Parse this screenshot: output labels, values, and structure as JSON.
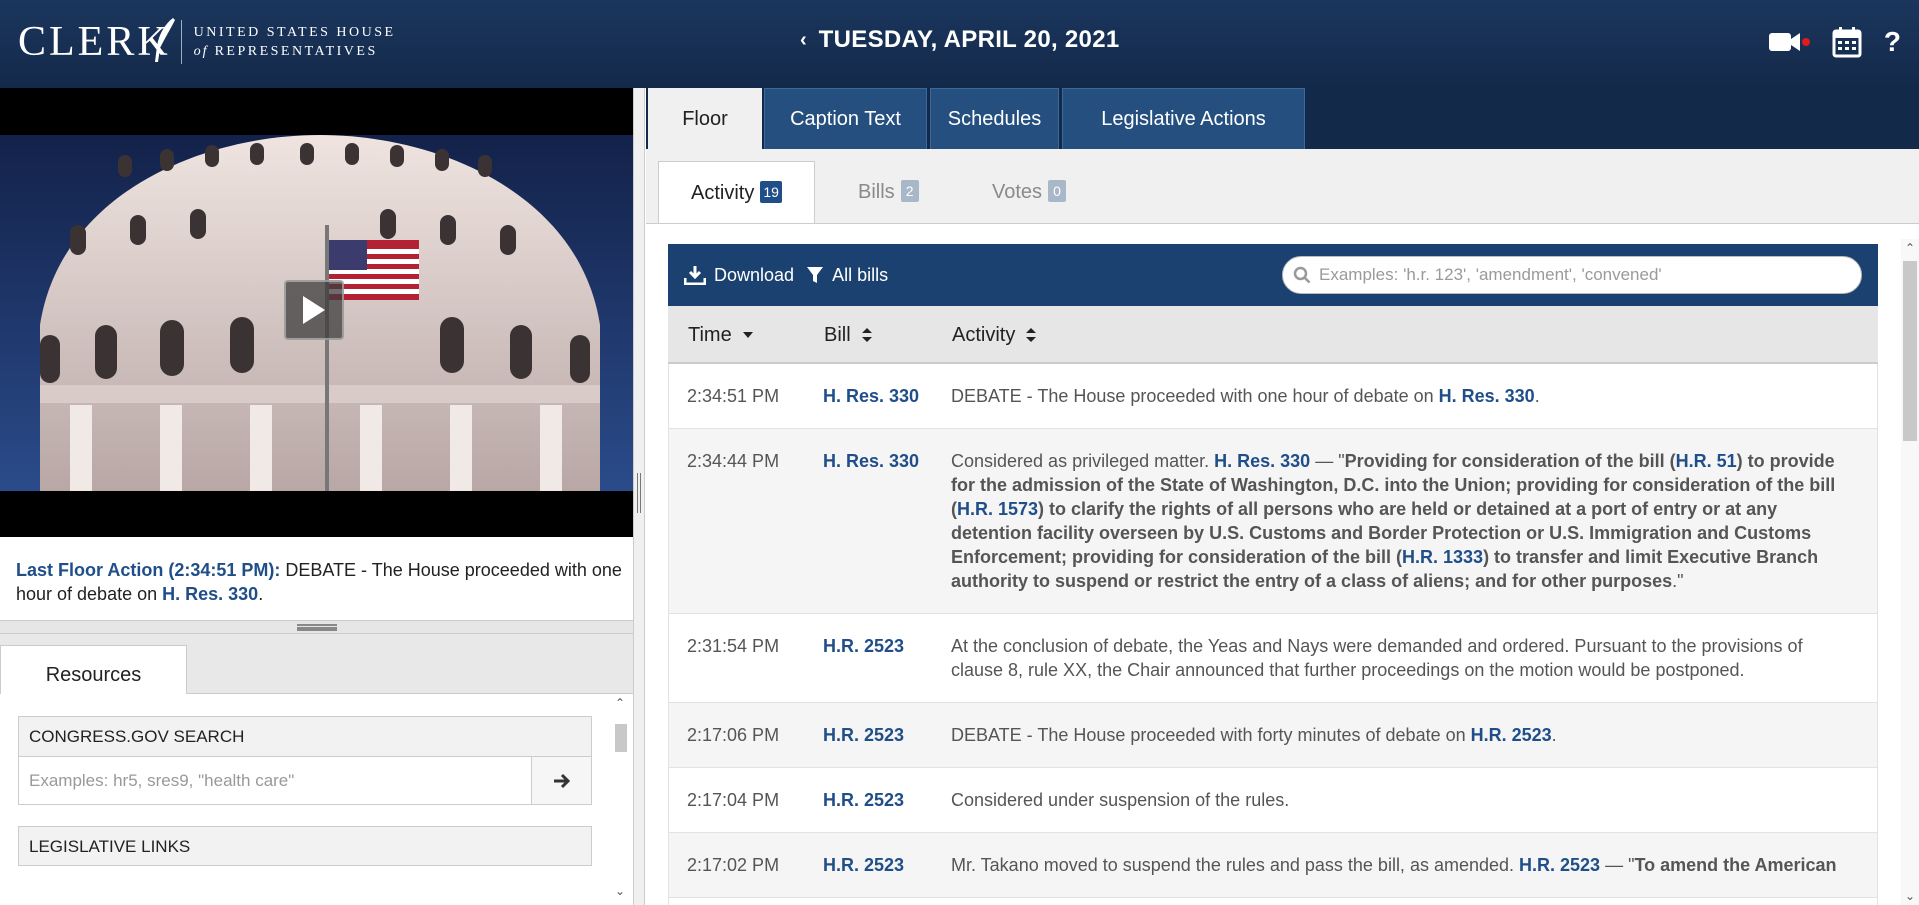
{
  "header": {
    "logo_main": "CLERK",
    "logo_sub_line1": "UNITED STATES HOUSE",
    "logo_sub_line2_italic": "of",
    "logo_sub_line2": "REPRESENTATIVES",
    "date": "TUESDAY, APRIL 20, 2021",
    "icons": [
      "video-camera-icon",
      "calendar-icon",
      "help-icon"
    ]
  },
  "last_floor_action": {
    "label": "Last Floor Action (2:34:51 PM):",
    "text": "DEBATE - The House proceeded with one hour of debate on",
    "bill": "H. Res. 330",
    "end": "."
  },
  "resources": {
    "tab": "Resources",
    "congress_title": "CONGRESS.GOV SEARCH",
    "congress_placeholder": "Examples: hr5, sres9, \"health care\"",
    "legislative_links": "LEGISLATIVE LINKS"
  },
  "top_tabs": [
    "Floor",
    "Caption Text",
    "Schedules",
    "Legislative Actions"
  ],
  "sub_tabs": [
    {
      "label": "Activity",
      "count": "19"
    },
    {
      "label": "Bills",
      "count": "2"
    },
    {
      "label": "Votes",
      "count": "0"
    }
  ],
  "toolbar": {
    "download": "Download",
    "filter": "All bills",
    "search_placeholder": "Examples: 'h.r. 123', 'amendment', 'convened'"
  },
  "columns": [
    "Time",
    "Bill",
    "Activity"
  ],
  "rows": [
    {
      "time": "2:34:51 PM",
      "bill": "H. Res. 330",
      "parts": [
        [
          "t",
          "DEBATE - The House proceeded with one hour of debate on "
        ],
        [
          "l",
          "H. Res. 330"
        ],
        [
          "t",
          "."
        ]
      ]
    },
    {
      "time": "2:34:44 PM",
      "bill": "H. Res. 330",
      "parts": [
        [
          "t",
          "Considered as privileged matter. "
        ],
        [
          "l",
          "H. Res. 330"
        ],
        [
          "t",
          " — \""
        ],
        [
          "b",
          "Providing for consideration of the bill ("
        ],
        [
          "l",
          "H.R. 51"
        ],
        [
          "b",
          ") to provide for the admission of the State of Washington, D.C. into the Union; providing for consideration of the bill ("
        ],
        [
          "l",
          "H.R. 1573"
        ],
        [
          "b",
          ") to clarify the rights of all persons who are held or detained at a port of entry or at any detention facility overseen by U.S. Customs and Border Protection or U.S. Immigration and Customs Enforcement; providing for consideration of the bill ("
        ],
        [
          "l",
          "H.R. 1333"
        ],
        [
          "b",
          ") to transfer and limit Executive Branch authority to suspend or restrict the entry of a class of aliens; and for other purposes"
        ],
        [
          "t",
          ".\""
        ]
      ]
    },
    {
      "time": "2:31:54 PM",
      "bill": "H.R. 2523",
      "parts": [
        [
          "t",
          "At the conclusion of debate, the Yeas and Nays were demanded and ordered. Pursuant to the provisions of clause 8, rule XX, the Chair announced that further proceedings on the motion would be postponed."
        ]
      ]
    },
    {
      "time": "2:17:06 PM",
      "bill": "H.R. 2523",
      "parts": [
        [
          "t",
          "DEBATE - The House proceeded with forty minutes of debate on "
        ],
        [
          "l",
          "H.R. 2523"
        ],
        [
          "t",
          "."
        ]
      ]
    },
    {
      "time": "2:17:04 PM",
      "bill": "H.R. 2523",
      "parts": [
        [
          "t",
          "Considered under suspension of the rules."
        ]
      ]
    },
    {
      "time": "2:17:02 PM",
      "bill": "H.R. 2523",
      "parts": [
        [
          "t",
          "Mr. Takano moved to suspend the rules and pass the bill, as amended. "
        ],
        [
          "l",
          "H.R. 2523"
        ],
        [
          "t",
          " — \""
        ],
        [
          "b",
          "To amend the American"
        ]
      ]
    }
  ]
}
